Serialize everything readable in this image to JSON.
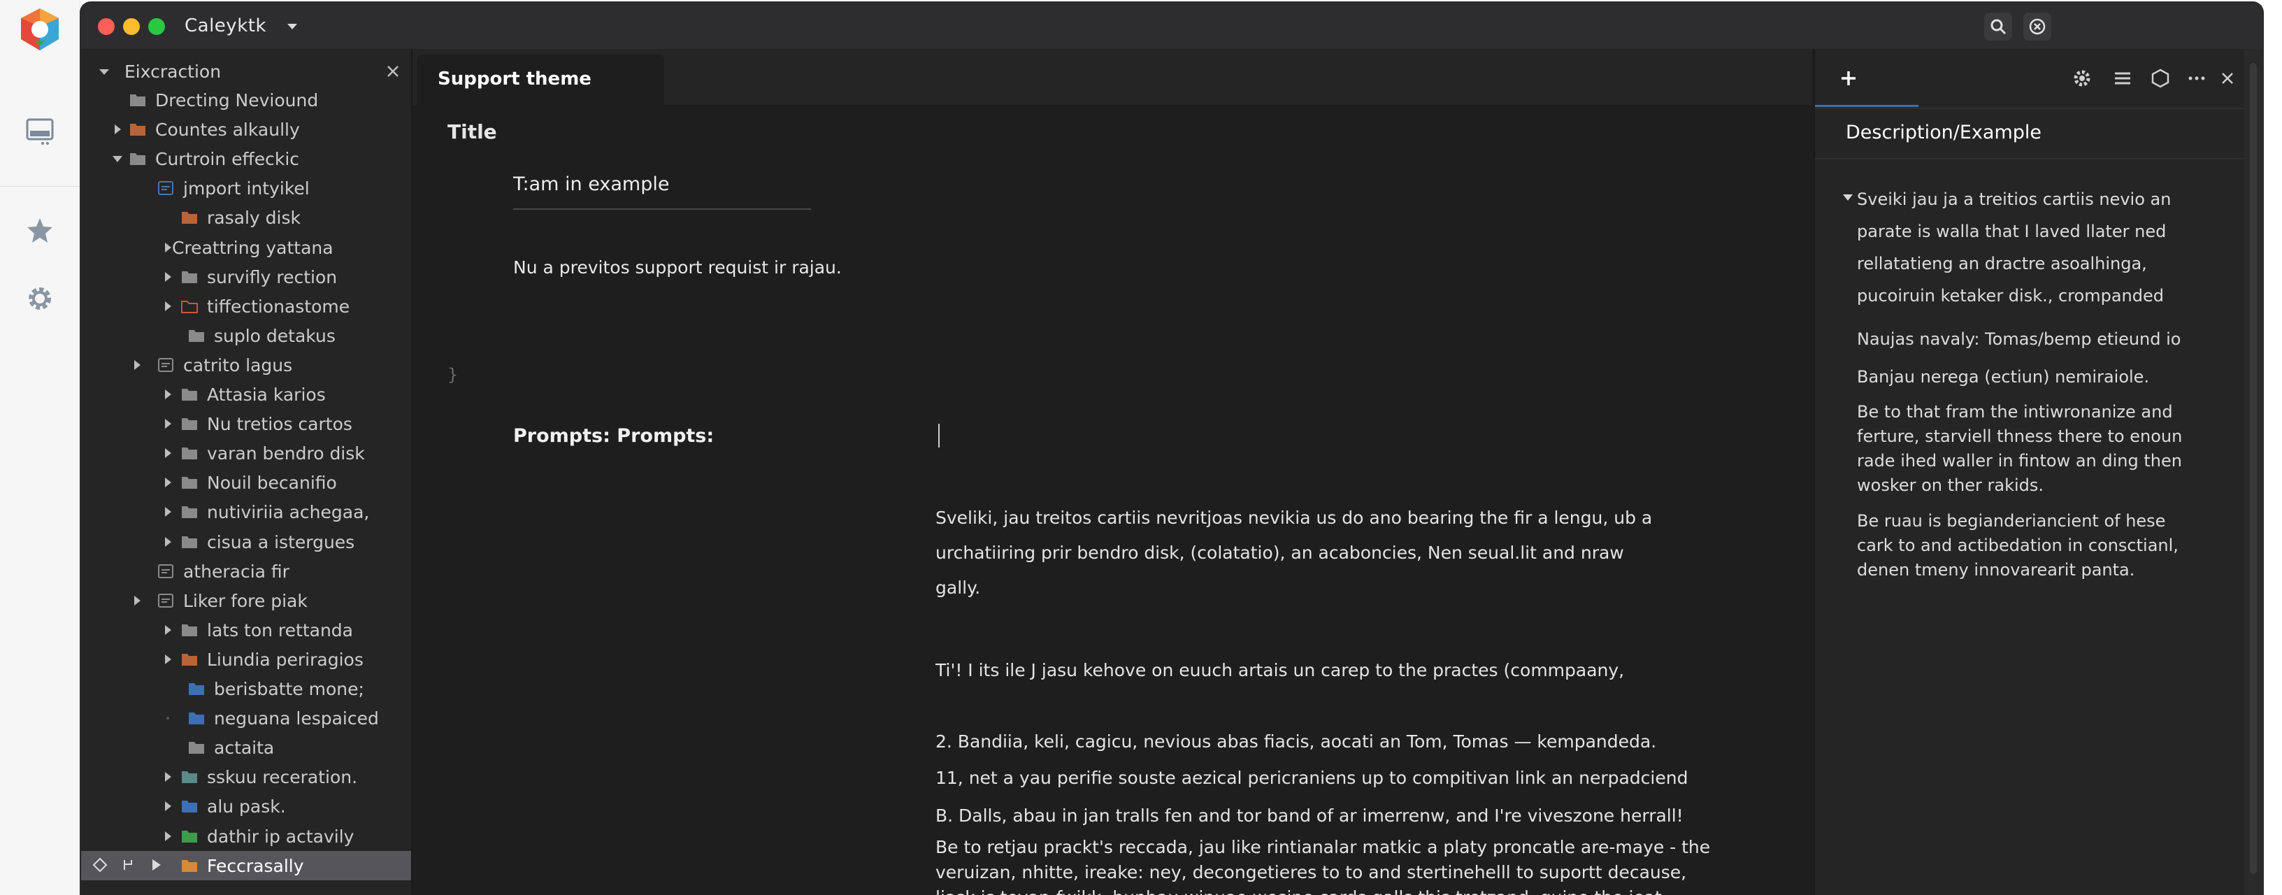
{
  "window": {
    "title": "Caleyktk"
  },
  "sidebar": {
    "header": "Eixcraction",
    "items": [
      {
        "label": "Drecting Neviound",
        "indent": 0,
        "caret": "none",
        "color": "#8a8a8a",
        "folder": "closed"
      },
      {
        "label": "Countes alkaully",
        "indent": 0,
        "caret": "right",
        "color": "#b8643a",
        "folder": "closed"
      },
      {
        "label": "Curtroin effeckic",
        "indent": 0,
        "caret": "down",
        "color": "#8a8a8a",
        "folder": "closed"
      },
      {
        "label": "jmport intyikel",
        "indent": 1,
        "caret": "none",
        "color": "#4a74b0",
        "folder": "file"
      },
      {
        "label": "rasaly disk",
        "indent": 2,
        "caret": "none",
        "color": "#b8643a",
        "folder": "closed"
      },
      {
        "label": "Creattring yattana",
        "indent": 2,
        "caret": "right",
        "color": "",
        "folder": "none"
      },
      {
        "label": "survifly rection",
        "indent": 2,
        "caret": "right",
        "color": "#8a8a8a",
        "folder": "closed"
      },
      {
        "label": "tiffectionastome",
        "indent": 2,
        "caret": "right",
        "color": "#c8563a",
        "folder": "outline"
      },
      {
        "label": "suplo detakus",
        "indent": 3,
        "caret": "none",
        "color": "#8a8a8a",
        "folder": "closed"
      },
      {
        "label": "catrito lagus",
        "indent": 1,
        "caret": "right",
        "color": "#8a8a8a",
        "folder": "file"
      },
      {
        "label": "Attasia karios",
        "indent": 2,
        "caret": "right",
        "color": "#8a8a8a",
        "folder": "closed"
      },
      {
        "label": "Nu tretios cartos",
        "indent": 2,
        "caret": "right",
        "color": "#8a8a8a",
        "folder": "closed"
      },
      {
        "label": "varan bendro disk",
        "indent": 2,
        "caret": "right",
        "color": "#8a8a8a",
        "folder": "closed"
      },
      {
        "label": "Nouil becanifio",
        "indent": 2,
        "caret": "right",
        "color": "#8a8a8a",
        "folder": "closed"
      },
      {
        "label": "nutiviriia achegaa,",
        "indent": 2,
        "caret": "right",
        "color": "#8a8a8a",
        "folder": "closed"
      },
      {
        "label": "cisua a istergues",
        "indent": 2,
        "caret": "right",
        "color": "#8a8a8a",
        "folder": "closed"
      },
      {
        "label": "atheracia fir",
        "indent": 1,
        "caret": "none",
        "color": "#8a8a8a",
        "folder": "file"
      },
      {
        "label": "Liker fore piak",
        "indent": 1,
        "caret": "right",
        "color": "#8a8a8a",
        "folder": "file"
      },
      {
        "label": "lats ton rettanda",
        "indent": 2,
        "caret": "right",
        "color": "#8a8a8a",
        "folder": "closed"
      },
      {
        "label": "Liundia periragios",
        "indent": 2,
        "caret": "right",
        "color": "#b8643a",
        "folder": "closed"
      },
      {
        "label": "berisbatte mone;",
        "indent": 3,
        "caret": "none",
        "color": "#3d6fb5",
        "folder": "closed"
      },
      {
        "label": "neguana lespaiced",
        "indent": 3,
        "caret": "dot",
        "color": "#3d6fb5",
        "folder": "closed"
      },
      {
        "label": "actaita",
        "indent": 3,
        "caret": "none",
        "color": "#8a8a8a",
        "folder": "closed"
      },
      {
        "label": "sskuu receration.",
        "indent": 2,
        "caret": "right",
        "color": "#5a8a8a",
        "folder": "closed"
      },
      {
        "label": "alu pask.",
        "indent": 2,
        "caret": "right",
        "color": "#3d6fb5",
        "folder": "closed"
      },
      {
        "label": "dathir ip actavily",
        "indent": 2,
        "caret": "right",
        "color": "#3f9b4c",
        "folder": "closed"
      },
      {
        "label": "Feccrasally",
        "indent": 2,
        "caret": "none",
        "color": "#d38a3a",
        "folder": "closed",
        "selected": true
      }
    ]
  },
  "editor": {
    "tab_label": "Support theme",
    "title_label": "Title",
    "input_label": "T:am in example",
    "line1": "Nu a previtos support requist ir rajau.",
    "brace": "}",
    "prompts_label": "Prompts:   Prompts:",
    "paragraphs": [
      {
        "lines": [
          "Sveliki,  jau treitos cartiis nevritjoas nevikia us do ano bearing the fir a lengu, ub a",
          "urchatiiring prir bendro disk, (colatatio), an acaboncies, Nen seual.lit and nraw",
          "gally."
        ],
        "tight": false
      },
      {
        "lines": [
          "Ti'! I its ile J jasu kehove on euuch artais un carep to the practes (commpaany,"
        ],
        "tight": false
      },
      {
        "lines": [
          "2.  Bandiia, keli, cagicu, nevious abas fiacis, aocati an Tom, Tomas — kempandeda."
        ],
        "tight": false
      },
      {
        "lines": [
          "11, net a yau perifie souste aezical pericraniens up to compitivan link an nerpadciend"
        ],
        "tight": false
      },
      {
        "lines": [
          "B. Dalls, abau in jan tralls fen and tor band of ar imerrenw, and I're viveszone herrall!"
        ],
        "tight": false
      },
      {
        "lines": [
          "Be to retjau prackt's reccada, jau like rintianalar matkic a platy proncatle are-maye - the",
          "veruizan, nhitte, ireake: ney, decongetieres to to and stertinehelll to suportt decause,",
          "ljask is teyan-fwikk, bunbau winuae wesipe cards galls this tretzand, guino the jeat"
        ],
        "tight": true
      }
    ]
  },
  "rpanel": {
    "heading": "Description/Example",
    "blocks": [
      {
        "lines": [
          "Sveiki jau ja a treitios cartiis nevio an",
          "parate is walla that I laved llater ned",
          "rellatatieng an dractre asoalhinga,",
          "pucoiruin ketaker disk., crompanded"
        ],
        "tight": false
      },
      {
        "lines": [
          "Naujas navaly: Tomas/bemp etieund io"
        ],
        "tight": false
      },
      {
        "lines": [
          "Banjau nerega (ectiun) nemiraiole."
        ],
        "tight": false
      },
      {
        "lines": [
          "Be to that fram the intiwronanize and",
          "ferture, starviell thness there to enoun",
          "rade ihed waller in fintow an ding then",
          "wosker on ther rakids."
        ],
        "tight": true
      },
      {
        "lines": [
          "Be ruau is begianderiancient of hese",
          "cark to and  actibedation in consctianl,",
          "denen tmeny innovarearit panta."
        ],
        "tight": true
      }
    ]
  },
  "colors": {
    "window_bg": "#1e1e1e",
    "sidebar_bg": "#252526",
    "accent": "#3c6fb0",
    "selected_row": "#56565a"
  }
}
